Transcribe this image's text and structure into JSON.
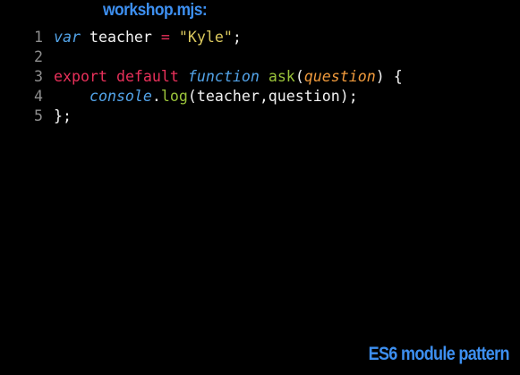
{
  "slide": {
    "file_title": "workshop.mjs:",
    "footer_title": "ES6 module pattern"
  },
  "colors": {
    "title": "#3d8ff0",
    "line_number": "#8e8e8e",
    "plain": "#f2f2f2",
    "keyword": "#e8305a",
    "storage": "#52a3e8",
    "string": "#dbc95e",
    "function_name": "#9ac33a",
    "parameter": "#f09a3c"
  },
  "code": {
    "line1": {
      "num": "1",
      "kw": "var",
      "ident": "teacher",
      "op": "=",
      "str": "\"Kyle\"",
      "end": ";"
    },
    "line2": {
      "num": "2"
    },
    "line3": {
      "num": "3",
      "kw_export": "export",
      "kw_default": "default",
      "kw_function": "function",
      "fn_name": "ask",
      "paren_open": "(",
      "param": "question",
      "paren_close": ")",
      "brace": "{"
    },
    "line4": {
      "num": "4",
      "obj": "console",
      "dot": ".",
      "method": "log",
      "args": "(teacher,question);"
    },
    "line5": {
      "num": "5",
      "end": "};"
    }
  }
}
